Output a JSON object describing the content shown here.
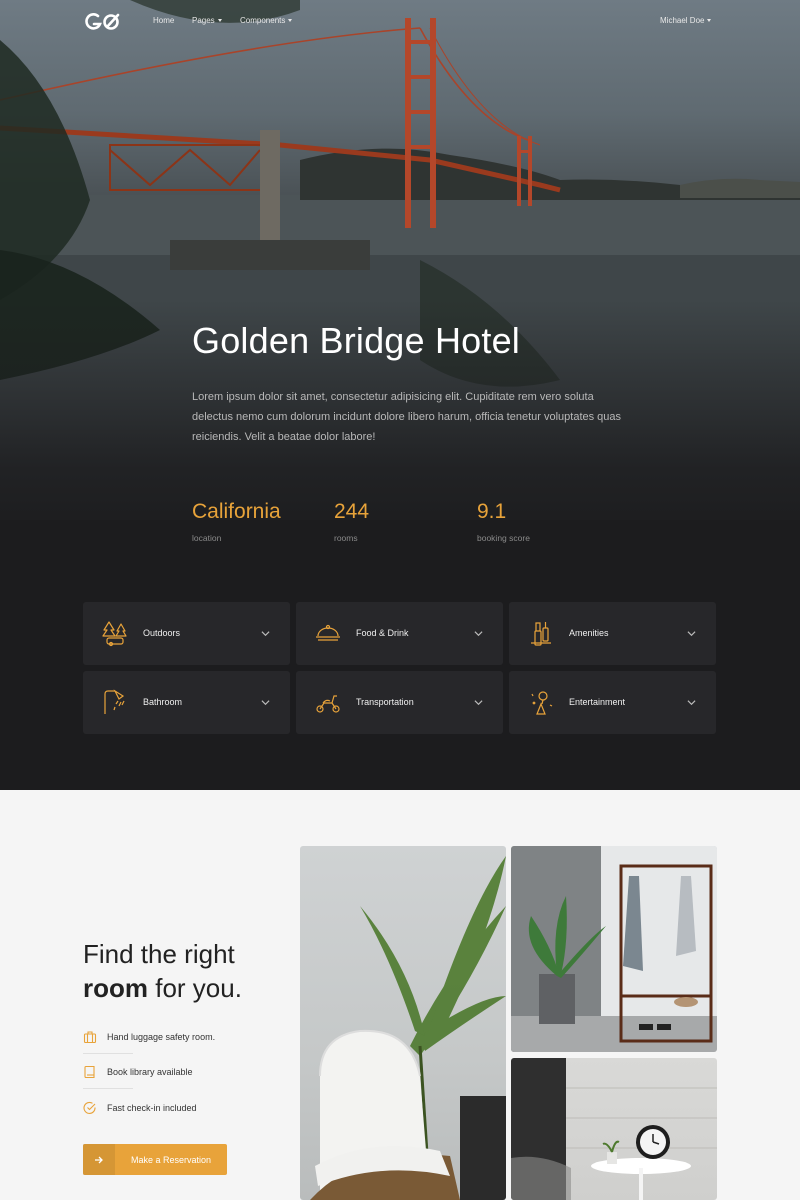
{
  "nav": {
    "links": [
      "Home",
      "Pages",
      "Components"
    ],
    "user": "Michael Doe"
  },
  "hero": {
    "title": "Golden Bridge Hotel",
    "description": "Lorem ipsum dolor sit amet, consectetur adipisicing elit. Cupiditate rem vero soluta delectus nemo cum dolorum incidunt dolore libero harum, officia tenetur voluptates quas reiciendis. Velit a beatae dolor labore!",
    "stats": [
      {
        "value": "California",
        "label": "location"
      },
      {
        "value": "244",
        "label": "rooms"
      },
      {
        "value": "9.1",
        "label": "booking score"
      }
    ]
  },
  "amenities": [
    {
      "label": "Outdoors",
      "icon": "camping-trees-icon"
    },
    {
      "label": "Food & Drink",
      "icon": "food-cloche-icon"
    },
    {
      "label": "Amenities",
      "icon": "toiletries-icon"
    },
    {
      "label": "Bathroom",
      "icon": "shower-icon"
    },
    {
      "label": "Transportation",
      "icon": "scooter-icon"
    },
    {
      "label": "Entertainment",
      "icon": "party-balloons-icon"
    }
  ],
  "rooms": {
    "title_line1": "Find the right",
    "title_bold": "room",
    "title_rest": " for you.",
    "features": [
      {
        "label": "Hand luggage safety room.",
        "icon": "luggage-icon"
      },
      {
        "label": "Book library available",
        "icon": "book-icon"
      },
      {
        "label": "Fast check-in included",
        "icon": "check-circle-icon"
      }
    ],
    "button_label": "Make a Reservation"
  },
  "colors": {
    "accent": "#e8a33a",
    "hero_bg": "#1c1c1e",
    "card_bg": "#27272a",
    "section_bg": "#f5f5f5"
  }
}
